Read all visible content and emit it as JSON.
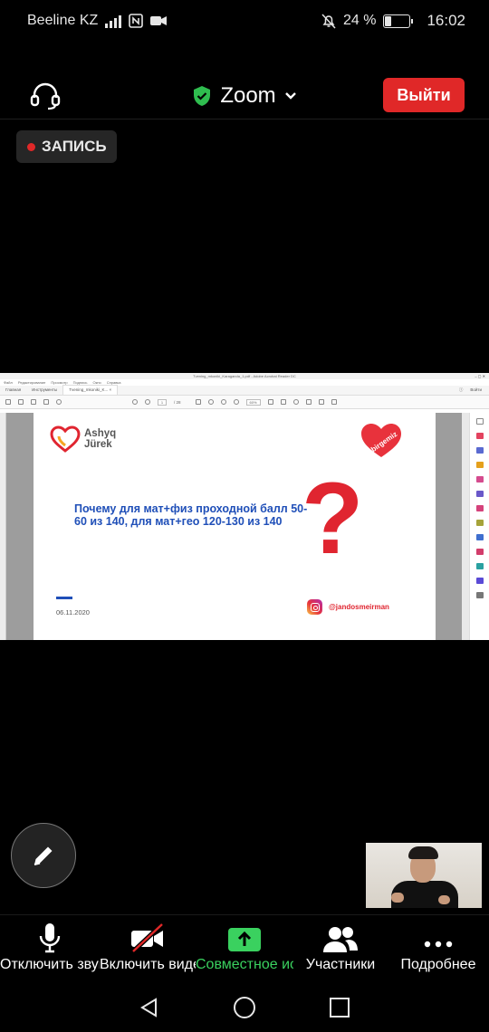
{
  "status_bar": {
    "carrier": "Beeline KZ",
    "battery_percent": "24 %",
    "battery_level": 0.24,
    "time": "16:02",
    "icons": [
      "signal-icon",
      "nfc-icon",
      "camera-icon",
      "mute-icon",
      "battery-icon"
    ]
  },
  "top_bar": {
    "title": "Zoom",
    "leave_label": "Выйти",
    "colors": {
      "shield": "#2fbd4f",
      "leave": "#e02828"
    }
  },
  "recording": {
    "label": "ЗАПИСЬ"
  },
  "shared_screen": {
    "window_title": "Tvening_mkoniki_Karaganda_1.pdf - Adobe Acrobat Reader DC",
    "menu": [
      "Файл",
      "Редактирование",
      "Просмотр",
      "Подпись",
      "Окно",
      "Справка"
    ],
    "tabs": [
      "Главная",
      "Инструменты",
      "Tvening_mkoniki_K..."
    ],
    "tab_close": "×",
    "enter_label": "Войти",
    "page_indicator": "/ 28",
    "page_current": "1",
    "zoom_level": "60%",
    "slide": {
      "logo_left": [
        "Ashyq",
        "Jürek"
      ],
      "logo_right": "birgemiz",
      "title": "Почему для мат+физ проходной балл 50-60 из 140, для мат+гео 120-130 из 140",
      "question_mark": "?",
      "date": "06.11.2020",
      "instagram_handle": "@jandosmeirman"
    }
  },
  "controls": [
    {
      "label": "Отключить звук",
      "icon": "microphone-icon"
    },
    {
      "label": "Включить видео",
      "icon": "video-off-icon"
    },
    {
      "label": "Совместное использование",
      "icon": "share-screen-icon"
    },
    {
      "label": "Участники",
      "icon": "participants-icon"
    },
    {
      "label": "Подробнее",
      "icon": "more-icon"
    }
  ],
  "nav": {
    "icons": [
      "back-icon",
      "home-icon",
      "recents-icon"
    ]
  }
}
